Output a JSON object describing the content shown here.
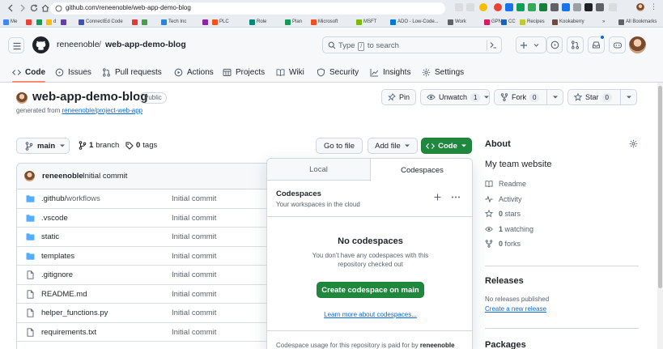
{
  "browser": {
    "url": "github.com/reneenoble/web-app-demo-blog",
    "bookmarks": [
      {
        "label": "Me",
        "color": "#4285f4"
      },
      {
        "label": "",
        "color": "#ea4335"
      },
      {
        "label": "",
        "color": "#0f9d58"
      },
      {
        "label": "d",
        "color": "#fbbc05"
      },
      {
        "label": "",
        "color": "#673ab7"
      },
      {
        "label": "ConnectEd Code",
        "color": "#3f51b5"
      },
      {
        "label": "",
        "color": "#e53935"
      },
      {
        "label": "",
        "color": "#43a047"
      },
      {
        "label": "Tech Inc",
        "color": "#1e88e5"
      },
      {
        "label": "",
        "color": "#8e24aa"
      },
      {
        "label": "PLC",
        "color": "#f4511e"
      },
      {
        "label": "Role",
        "color": "#00897b"
      },
      {
        "label": "Plan",
        "color": "#0f9d58"
      },
      {
        "label": "Microsoft",
        "color": "#f25022"
      },
      {
        "label": "MSFT",
        "color": "#7cbb00"
      },
      {
        "label": "ADO - Low-Code...",
        "color": "#0078d4"
      },
      {
        "label": "Work",
        "color": "#5f6368"
      },
      {
        "label": "GPN",
        "color": "#d81b60"
      },
      {
        "label": "CC",
        "color": "#1565c0"
      },
      {
        "label": "Recipes",
        "color": "#c0ca33"
      },
      {
        "label": "Kookaberry",
        "color": "#6d4c41"
      },
      {
        "label": "All Bookmarks",
        "color": "#5f6368"
      }
    ],
    "more_bookmarks": "»"
  },
  "header": {
    "owner": "reneenoble",
    "separator": "/",
    "repo": "web-app-demo-blog",
    "search_before": "Type",
    "search_key": "/",
    "search_after": "to search"
  },
  "tabs": [
    {
      "label": "Code",
      "icon": "code-icon"
    },
    {
      "label": "Issues",
      "icon": "issue-icon"
    },
    {
      "label": "Pull requests",
      "icon": "pull-request-icon"
    },
    {
      "label": "Actions",
      "icon": "play-icon"
    },
    {
      "label": "Projects",
      "icon": "table-icon"
    },
    {
      "label": "Wiki",
      "icon": "book-icon"
    },
    {
      "label": "Security",
      "icon": "shield-icon"
    },
    {
      "label": "Insights",
      "icon": "graph-icon"
    },
    {
      "label": "Settings",
      "icon": "gear-icon"
    }
  ],
  "repo": {
    "name": "web-app-demo-blog",
    "visibility": "Public",
    "generated_prefix": "generated from",
    "template": "reneenoble/project-web-app",
    "pin_label": "Pin",
    "unwatch_label": "Unwatch",
    "watch_count": "1",
    "fork_label": "Fork",
    "fork_count": "0",
    "star_label": "Star",
    "star_count": "0"
  },
  "toolbar": {
    "branch": "main",
    "branch_count": "1",
    "branch_word": "branch",
    "tag_count": "0",
    "tag_word": "tags",
    "goto_label": "Go to file",
    "add_label": "Add file",
    "code_label": "Code"
  },
  "commit": {
    "author": "reneenoble",
    "message": "Initial commit"
  },
  "files": [
    {
      "name": ".github/",
      "name_dim": "workflows",
      "type": "folder",
      "message": "Initial commit"
    },
    {
      "name": ".vscode",
      "name_dim": "",
      "type": "folder",
      "message": "Initial commit"
    },
    {
      "name": "static",
      "name_dim": "",
      "type": "folder",
      "message": "Initial commit"
    },
    {
      "name": "templates",
      "name_dim": "",
      "type": "folder",
      "message": "Initial commit"
    },
    {
      "name": ".gitignore",
      "name_dim": "",
      "type": "file",
      "message": "Initial commit"
    },
    {
      "name": "README.md",
      "name_dim": "",
      "type": "file",
      "message": "Initial commit"
    },
    {
      "name": "helper_functions.py",
      "name_dim": "",
      "type": "file",
      "message": "Initial commit"
    },
    {
      "name": "requirements.txt",
      "name_dim": "",
      "type": "file",
      "message": "Initial commit"
    }
  ],
  "popover": {
    "tab_local": "Local",
    "tab_codespaces": "Codespaces",
    "title": "Codespaces",
    "subtitle": "Your workspaces in the cloud",
    "empty_title": "No codespaces",
    "empty_desc": "You don't have any codespaces with this repository checked out",
    "create_label": "Create codespace on main",
    "learn_label": "Learn more about codespaces...",
    "usage_prefix": "Codespace usage for this repository is paid for by",
    "usage_owner": "reneenoble"
  },
  "about": {
    "title": "About",
    "description": "My team website",
    "items": [
      {
        "icon": "book-icon",
        "value": "",
        "label": "Readme"
      },
      {
        "icon": "pulse-icon",
        "value": "",
        "label": "Activity"
      },
      {
        "icon": "star-icon",
        "value": "0",
        "label": "stars"
      },
      {
        "icon": "eye-icon",
        "value": "1",
        "label": "watching"
      },
      {
        "icon": "fork-icon",
        "value": "0",
        "label": "forks"
      }
    ],
    "releases_title": "Releases",
    "releases_note": "No releases published",
    "releases_link": "Create a new release",
    "packages_title": "Packages"
  },
  "colors": {
    "accent_green": "#1f883d",
    "link_blue": "#0969da",
    "tab_underline": "#fd8c73"
  }
}
